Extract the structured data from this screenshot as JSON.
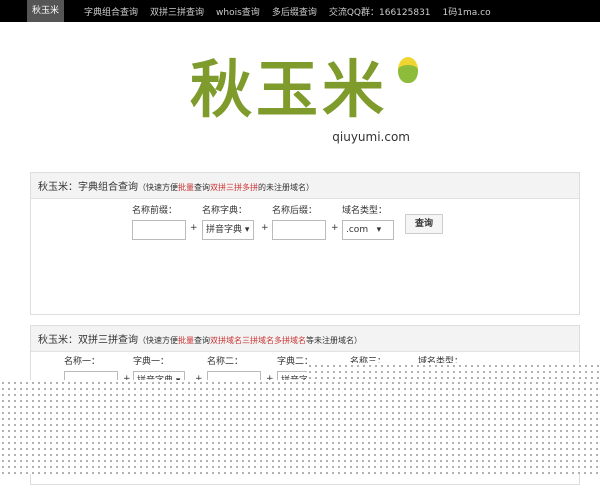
{
  "nav": {
    "brand": "秋玉米",
    "items": [
      "字典组合查询",
      "双拼三拼查询",
      "whois查询",
      "多后缀查询",
      "交流QQ群：166125831",
      "1码1ma.co"
    ]
  },
  "logo": {
    "text": "秋玉米",
    "domain": "qiuyumi.com"
  },
  "panel1": {
    "title": "秋玉米：字典组合查询",
    "desc_pre": "（快速方便",
    "desc_red1": "批量",
    "desc_mid": "查询",
    "desc_red2": "双拼三拼多拼",
    "desc_post": "的未注册域名）",
    "labels": [
      "名称前缀：",
      "名称字典：",
      "名称后缀：",
      "域名类型："
    ],
    "dict_value": "拼音字典 ▾",
    "tld_value": ".com",
    "search": "查询",
    "prefix": "",
    "suffix": ""
  },
  "panel2": {
    "title": "秋玉米：双拼三拼查询",
    "desc_pre": "（快速方便",
    "desc_red1": "批量",
    "desc_mid": "查询",
    "desc_red2": "双拼域名三拼域名多拼域名",
    "desc_post": "等未注册域名）",
    "labels": [
      "名称一：",
      "字典一：",
      "名称二：",
      "字典二：",
      "名称三：",
      "域名类型："
    ],
    "dict1_value": "拼音字典 ▾",
    "dict2_value": "拼音字"
  },
  "plus": "+"
}
